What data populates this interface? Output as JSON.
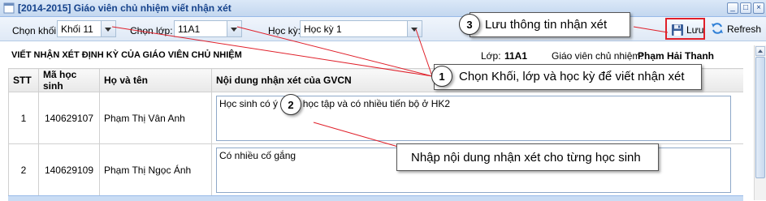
{
  "window": {
    "title": "[2014-2015] Giáo viên chủ nhiệm viết nhận xét",
    "buttons": [
      "_",
      "□",
      "×"
    ]
  },
  "toolbar": {
    "khoi_label": "Chọn khối:",
    "khoi_value": "Khối 11",
    "lop_label": "Chọn lớp:",
    "lop_value": "11A1",
    "hocky_label": "Học kỳ:",
    "hocky_value": "Học kỳ 1",
    "save_label": "Lưu",
    "refresh_label": "Refresh"
  },
  "info": {
    "heading": "VIẾT NHẬN XÉT ĐỊNH KỲ CỦA GIÁO VIÊN CHỦ NHIỆM",
    "lop_label": "Lớp:",
    "lop_value": "11A1",
    "gv_label": "Giáo viên chủ nhiệm:",
    "gv_value": "Phạm Hải Thanh"
  },
  "table": {
    "headers": [
      "STT",
      "Mã học sinh",
      "Họ và tên",
      "Nội dung nhận xét của GVCN"
    ],
    "rows": [
      {
        "stt": "1",
        "code": "140629107",
        "name": "Phạm Thị Vân Anh",
        "note": "Học sinh có ý thức học tập và có nhiều tiến bộ ở HK2"
      },
      {
        "stt": "2",
        "code": "140629109",
        "name": "Phạm Thị Ngọc Ánh",
        "note": "Có nhiều cố gắng"
      }
    ]
  },
  "annotations": {
    "c1_num": "1",
    "c1_text": "Chọn Khối, lớp và học kỳ để viết nhận xét",
    "c2_num": "2",
    "c2_text": "Nhập nội dung nhận xét cho từng học sinh",
    "c3_num": "3",
    "c3_text": "Lưu thông tin nhận xét"
  },
  "colors": {
    "accent": "#15428b",
    "highlight_border": "#e0202a",
    "annotation_line": "#e0202a"
  }
}
